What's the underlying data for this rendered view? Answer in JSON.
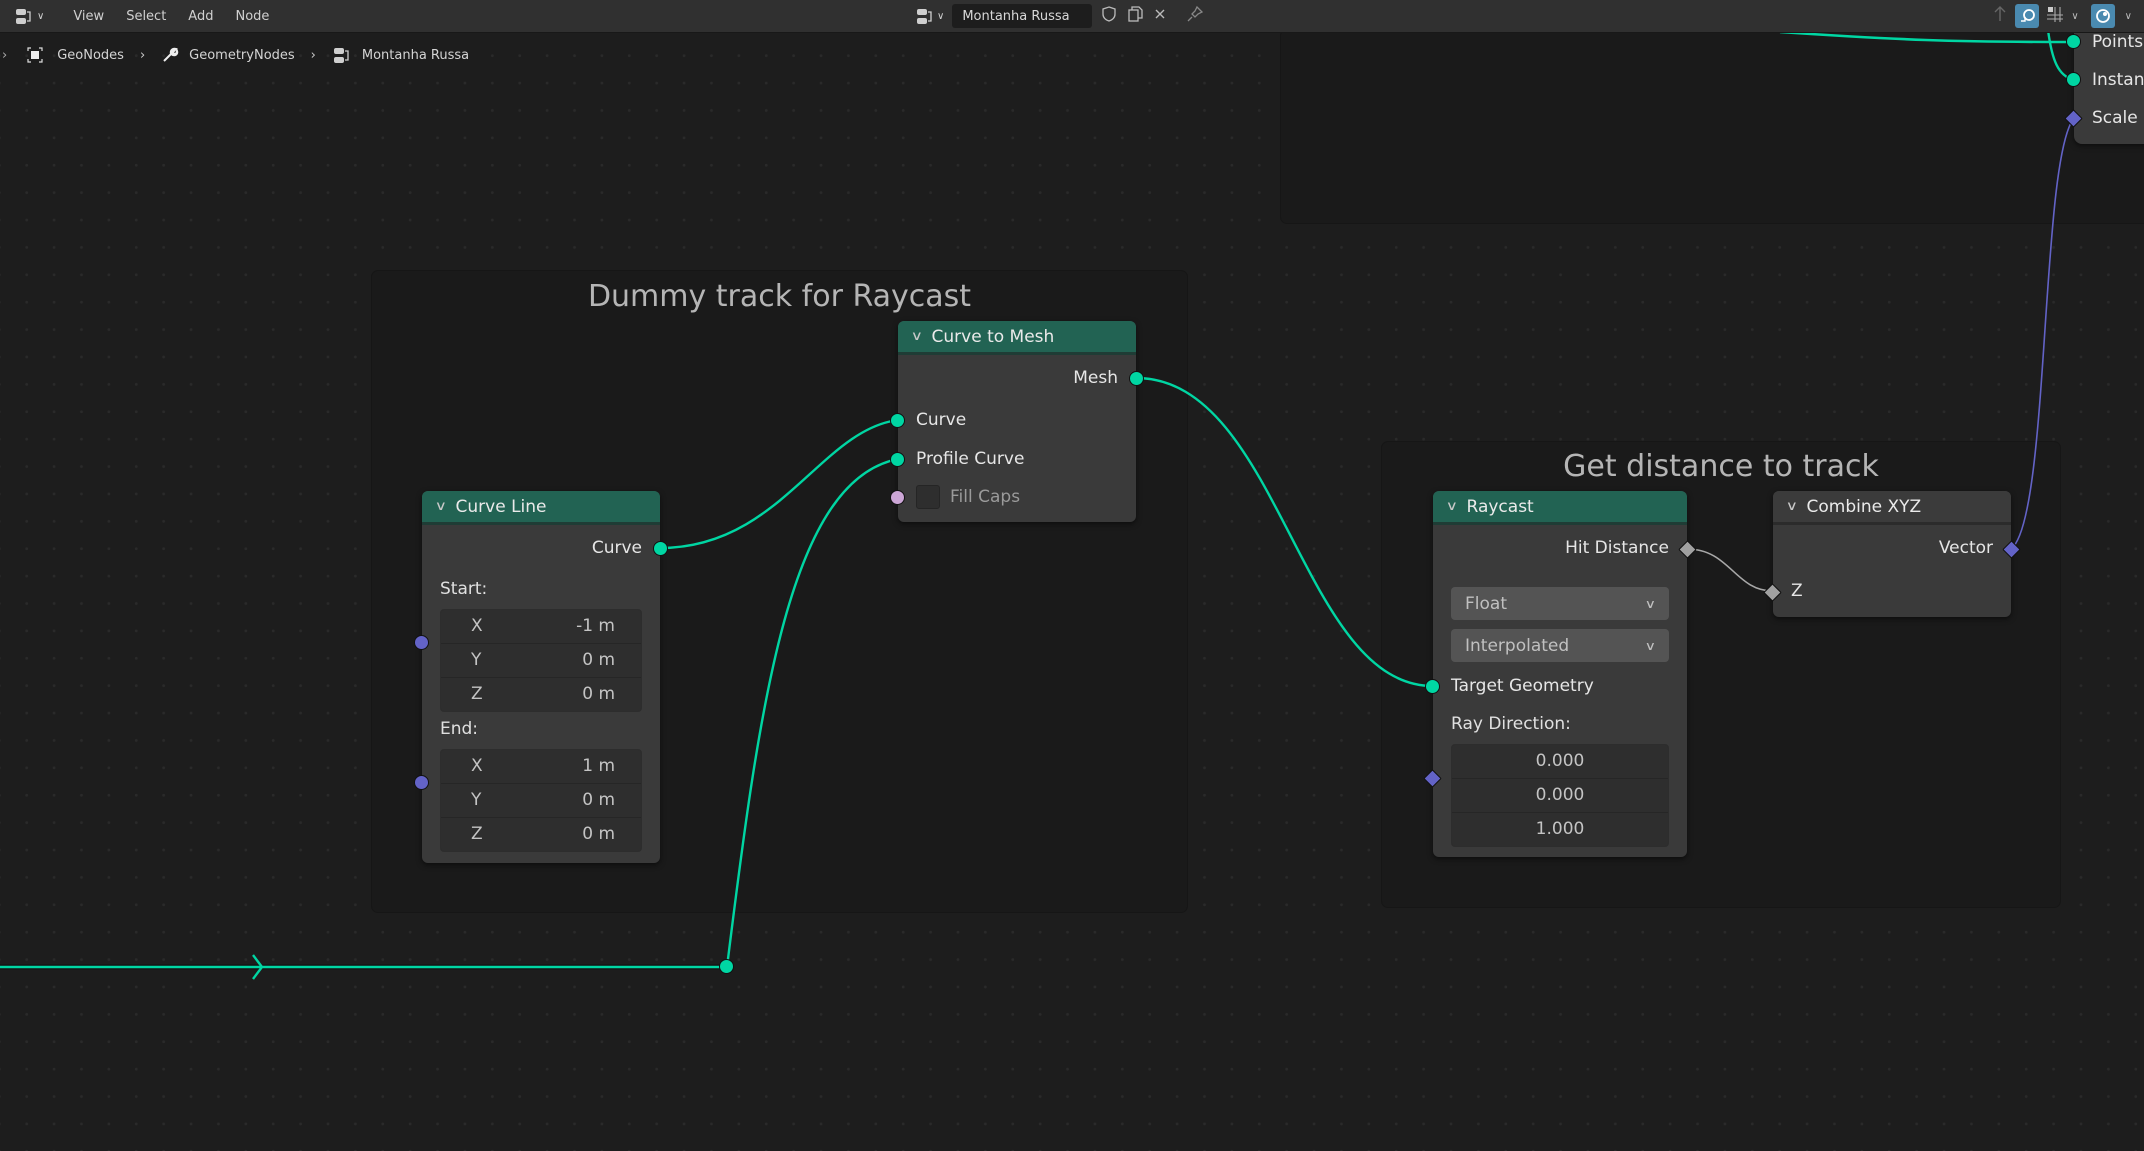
{
  "header": {
    "menu": [
      "View",
      "Select",
      "Add",
      "Node"
    ],
    "node_tree_name": "Montanha Russa",
    "icons": {
      "editor_type": "node-editor-icon",
      "fake_user": "shield-icon",
      "duplicate": "duplicate-icon",
      "unlink": "close-icon",
      "pin": "pin-icon",
      "parent": "arrow-up-icon",
      "overlay": "overlay-icon",
      "snap": "snap-grid-icon",
      "gizmo": "gizmo-icon"
    }
  },
  "breadcrumb": [
    "GeoNodes",
    "GeometryNodes",
    "Montanha Russa"
  ],
  "frames": {
    "dummy": {
      "title": "Dummy track for Raycast"
    },
    "distance": {
      "title": "Get distance to track"
    }
  },
  "nodes": {
    "curve_to_mesh": {
      "title": "Curve to Mesh",
      "outputs": [
        "Mesh"
      ],
      "inputs": [
        "Curve",
        "Profile Curve",
        "Fill Caps"
      ]
    },
    "curve_line": {
      "title": "Curve Line",
      "output": "Curve",
      "start_label": "Start:",
      "start": [
        {
          "axis": "X",
          "value": "-1 m"
        },
        {
          "axis": "Y",
          "value": "0 m"
        },
        {
          "axis": "Z",
          "value": "0 m"
        }
      ],
      "end_label": "End:",
      "end": [
        {
          "axis": "X",
          "value": "1 m"
        },
        {
          "axis": "Y",
          "value": "0 m"
        },
        {
          "axis": "Z",
          "value": "0 m"
        }
      ]
    },
    "raycast": {
      "title": "Raycast",
      "output": "Hit Distance",
      "data_type": "Float",
      "mapping": "Interpolated",
      "input_geometry": "Target Geometry",
      "ray_direction_label": "Ray Direction:",
      "ray_direction": [
        "0.000",
        "0.000",
        "1.000"
      ]
    },
    "combine_xyz": {
      "title": "Combine XYZ",
      "output": "Vector",
      "input": "Z"
    },
    "offscreen_node": {
      "inputs": [
        "Points",
        "Instance",
        "Scale"
      ]
    }
  },
  "colors": {
    "geometry_socket": "#00d6a3",
    "vector_socket": "#6363c7",
    "float_socket": "#a1a1a1",
    "boolean_socket": "#cca6d6",
    "geometry_node_header": "#226353"
  }
}
